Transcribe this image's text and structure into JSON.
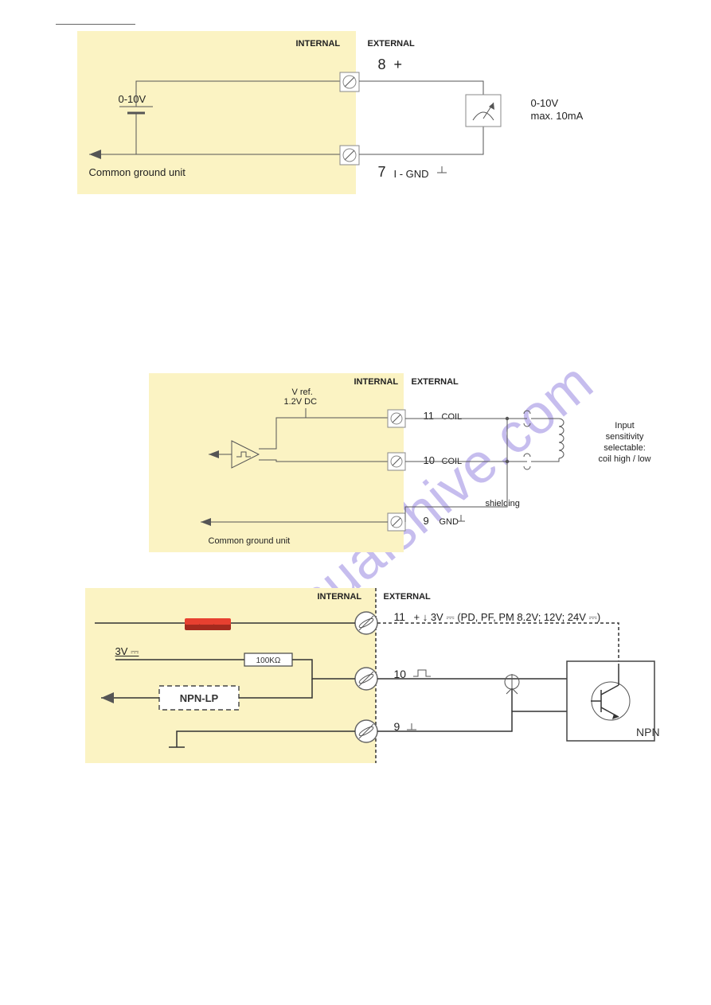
{
  "figure1": {
    "internalLabel": "INTERNAL",
    "externalLabel": "EXTERNAL",
    "term8": "8",
    "term8sym": "+",
    "term7": "7",
    "term7label": "I - GND",
    "sourceRange": "0-10V",
    "loadRange": "0-10V",
    "loadMax": "max. 10mA",
    "commonGround": "Common ground unit"
  },
  "figure2": {
    "internalLabel": "INTERNAL",
    "externalLabel": "EXTERNAL",
    "vref": "V ref.",
    "vrefVal": "1.2V DC",
    "term11": "11",
    "term11label": "COIL",
    "term10": "10",
    "term10label": "COIL",
    "term9": "9",
    "term9label": "GND",
    "shielding": "shielding",
    "sensitivityL1": "Input",
    "sensitivityL2": "sensitivity",
    "sensitivityL3": "selectable:",
    "sensitivityL4": "coil high / low",
    "commonGround": "Common ground unit"
  },
  "figure3": {
    "internalLabel": "INTERNAL",
    "externalLabel": "EXTERNAL",
    "term11": "11",
    "term11label": "+ ↓ 3V ⎓ (PD, PF, PM 8.2V; 12V; 24V ⎓)",
    "term10": "10",
    "term9": "9",
    "rail3v": "3V ⎓",
    "resistor": "100KΩ",
    "block": "NPN-LP",
    "npn": "NPN"
  }
}
